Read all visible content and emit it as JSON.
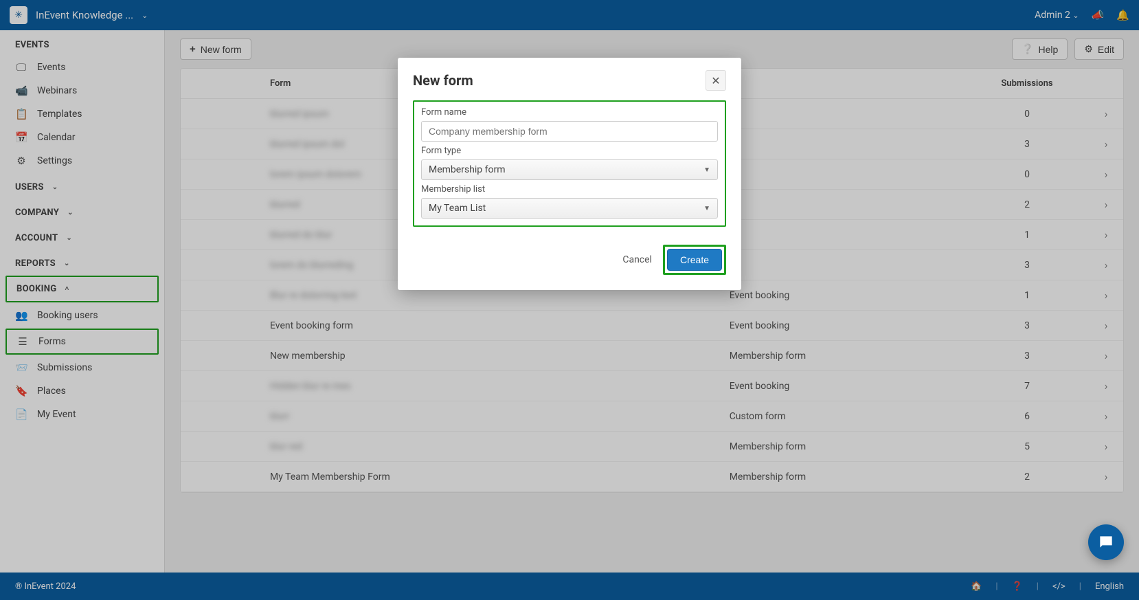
{
  "topbar": {
    "app_title": "InEvent Knowledge ...",
    "admin_name": "Admin 2"
  },
  "sidebar": {
    "events_header": "EVENTS",
    "events_items": [
      "Events",
      "Webinars",
      "Templates",
      "Calendar",
      "Settings"
    ],
    "users_header": "USERS",
    "company_header": "COMPANY",
    "account_header": "ACCOUNT",
    "reports_header": "REPORTS",
    "booking_header": "BOOKING",
    "booking_items": [
      "Booking users",
      "Forms",
      "Submissions",
      "Places",
      "My Event"
    ]
  },
  "toolbar": {
    "new_form": "New form",
    "help": "Help",
    "edit": "Edit"
  },
  "table": {
    "col_form": "Form",
    "col_type": "",
    "col_sub": "Submissions",
    "rows": [
      {
        "name": "blurred ipsum",
        "type": "",
        "sub": "0",
        "blur": true
      },
      {
        "name": "blurred ipsum dol",
        "type": "",
        "sub": "3",
        "blur": true
      },
      {
        "name": "lorem ipsum dolorem",
        "type": "",
        "sub": "0",
        "blur": true
      },
      {
        "name": "blurred",
        "type": "",
        "sub": "2",
        "blur": true
      },
      {
        "name": "blurred do blur",
        "type": "",
        "sub": "1",
        "blur": true
      },
      {
        "name": "lorem do blurreding",
        "type": "",
        "sub": "3",
        "blur": true
      },
      {
        "name": "Blur re dolorring text",
        "type": "Event booking",
        "sub": "1",
        "blur": true
      },
      {
        "name": "Event booking form",
        "type": "Event booking",
        "sub": "3",
        "blur": false
      },
      {
        "name": "New membership",
        "type": "Membership form",
        "sub": "3",
        "blur": false
      },
      {
        "name": "Hidden blur re mes",
        "type": "Event booking",
        "sub": "7",
        "blur": true
      },
      {
        "name": "blurr",
        "type": "Custom form",
        "sub": "6",
        "blur": true
      },
      {
        "name": "blur red",
        "type": "Membership form",
        "sub": "5",
        "blur": true
      },
      {
        "name": "My Team Membership Form",
        "type": "Membership form",
        "sub": "2",
        "blur": false
      }
    ]
  },
  "modal": {
    "title": "New form",
    "form_name_label": "Form name",
    "form_name_placeholder": "Company membership form",
    "form_type_label": "Form type",
    "form_type_value": "Membership form",
    "membership_list_label": "Membership list",
    "membership_list_value": "My Team List",
    "cancel": "Cancel",
    "create": "Create"
  },
  "footer": {
    "copyright": "® InEvent 2024",
    "language": "English"
  }
}
